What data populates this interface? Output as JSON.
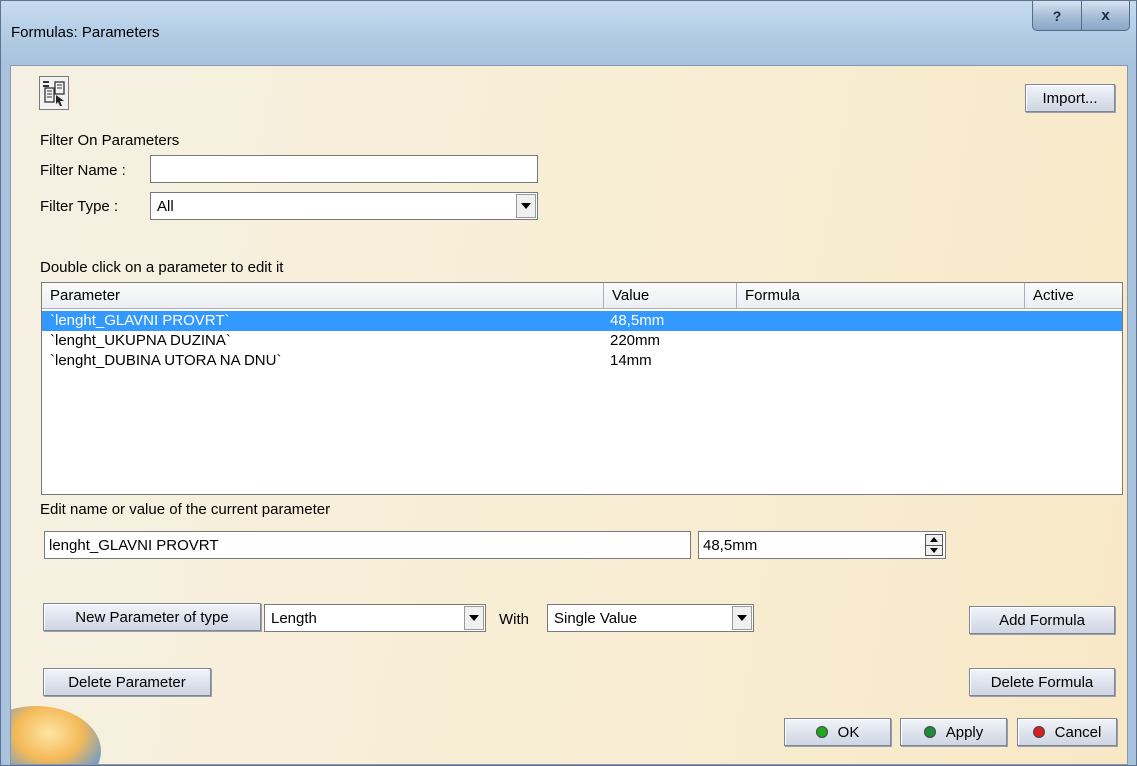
{
  "window": {
    "title": "Formulas: Parameters",
    "help_label": "?",
    "close_label": "x"
  },
  "toolbar": {
    "import_label": "Import..."
  },
  "filter": {
    "section_label": "Filter On Parameters",
    "name_label": "Filter Name :",
    "name_value": "",
    "type_label": "Filter Type :",
    "type_value": "All"
  },
  "list": {
    "caption": "Double click on a parameter to edit it",
    "columns": [
      "Parameter",
      "Value",
      "Formula",
      "Active"
    ],
    "rows": [
      {
        "parameter": "`lenght_GLAVNI PROVRT`",
        "value": "48,5mm",
        "formula": "",
        "active": "",
        "selected": true
      },
      {
        "parameter": "`lenght_UKUPNA DUZINA`",
        "value": "220mm",
        "formula": "",
        "active": "",
        "selected": false
      },
      {
        "parameter": "`lenght_DUBINA UTORA NA DNU`",
        "value": "14mm",
        "formula": "",
        "active": "",
        "selected": false
      }
    ]
  },
  "edit": {
    "caption": "Edit name or value of the current parameter",
    "name_value": "lenght_GLAVNI PROVRT",
    "value_value": "48,5mm"
  },
  "new_param": {
    "button_label": "New Parameter of type",
    "type_value": "Length",
    "with_label": "With",
    "with_value": "Single Value"
  },
  "actions": {
    "add_formula": "Add Formula",
    "delete_parameter": "Delete Parameter",
    "delete_formula": "Delete Formula",
    "ok": "OK",
    "apply": "Apply",
    "cancel": "Cancel"
  },
  "colors": {
    "selection": "#3399ff",
    "ok_dot": "#1fa81f",
    "apply_dot": "#1f8a3a",
    "cancel_dot": "#d42020"
  },
  "icons": [
    "parameter-tree-icon",
    "dropdown-arrow-icon",
    "spinner-up-icon",
    "spinner-down-icon",
    "ok-icon",
    "apply-icon",
    "cancel-icon"
  ]
}
